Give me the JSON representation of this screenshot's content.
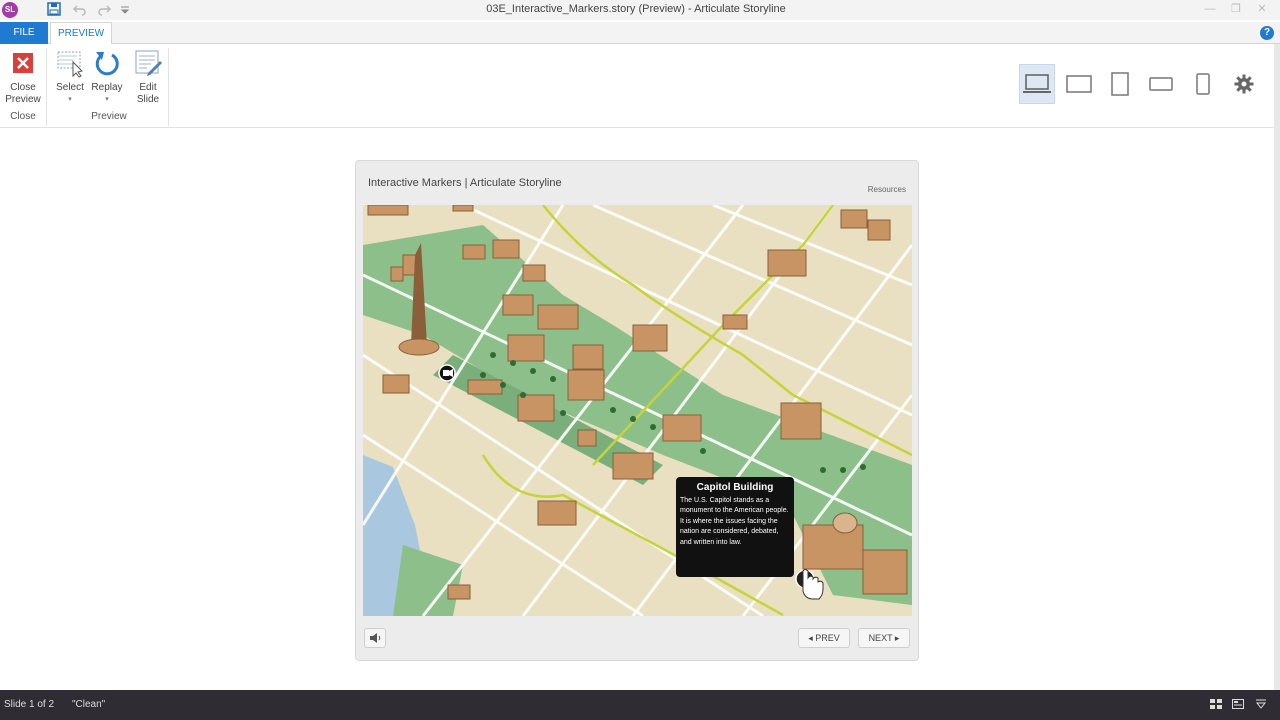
{
  "window": {
    "app_logo": "SL",
    "title": "03E_Interactive_Markers.story (Preview)  -  Articulate Storyline",
    "minimize": "—",
    "restore": "❐",
    "close": "✕"
  },
  "tabs": {
    "file": "FILE",
    "preview": "PREVIEW",
    "help": "?"
  },
  "ribbon": {
    "close_preview": {
      "line1": "Close",
      "line2": "Preview"
    },
    "close_group": "Close",
    "select": "Select",
    "replay": "Replay",
    "edit_slide": {
      "line1": "Edit",
      "line2": "Slide"
    },
    "preview_group": "Preview"
  },
  "player": {
    "title": "Interactive Markers | Articulate Storyline",
    "resources": "Resources",
    "prev": "◂  PREV",
    "next": "NEXT  ▸"
  },
  "tooltip": {
    "title": "Capitol Building",
    "body": "The U.S. Capitol stands as a monument to the American people. It is where the issues facing the nation are considered, debated, and written into law."
  },
  "status": {
    "slide": "Slide 1 of 2",
    "theme": "\"Clean\""
  },
  "colors": {
    "accent": "#1f7ad1",
    "close_red": "#d9403a",
    "status_bg": "#2f2d33",
    "map_green": "#8cbf8a",
    "map_tan": "#e9dfc1",
    "building": "#c89464"
  }
}
